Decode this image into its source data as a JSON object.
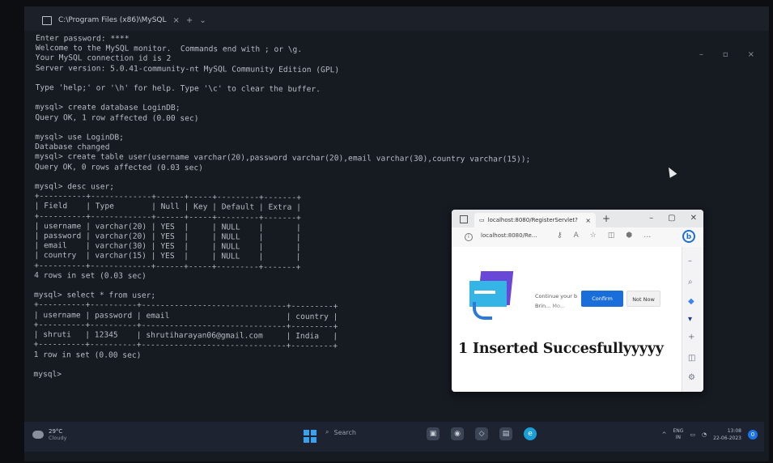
{
  "terminal": {
    "tab_title": "C:\\Program Files (x86)\\MySQL",
    "lines": [
      "Enter password: ****",
      "Welcome to the MySQL monitor.  Commands end with ; or \\g.",
      "Your MySQL connection id is 2",
      "Server version: 5.0.41-community-nt MySQL Community Edition (GPL)",
      "",
      "Type 'help;' or '\\h' for help. Type '\\c' to clear the buffer.",
      "",
      "mysql> create database LoginDB;",
      "Query OK, 1 row affected (0.00 sec)",
      "",
      "mysql> use LoginDB;",
      "Database changed",
      "mysql> create table user(username varchar(20),password varchar(20),email varchar(30),country varchar(15));",
      "Query OK, 0 rows affected (0.03 sec)",
      "",
      "mysql> desc user;",
      "+----------+-------------+------+-----+---------+-------+",
      "| Field    | Type        | Null | Key | Default | Extra |",
      "+----------+-------------+------+-----+---------+-------+",
      "| username | varchar(20) | YES  |     | NULL    |       |",
      "| password | varchar(20) | YES  |     | NULL    |       |",
      "| email    | varchar(30) | YES  |     | NULL    |       |",
      "| country  | varchar(15) | YES  |     | NULL    |       |",
      "+----------+-------------+------+-----+---------+-------+",
      "4 rows in set (0.03 sec)",
      "",
      "mysql> select * from user;",
      "+----------+----------+-------------------------------+---------+",
      "| username | password | email                         | country |",
      "+----------+----------+-------------------------------+---------+",
      "| shruti   | 12345    | shrutiharayan06@gmail.com     | India   |",
      "+----------+----------+-------------------------------+---------+",
      "1 row in set (0.00 sec)",
      "",
      "mysql>"
    ]
  },
  "browser": {
    "tab_title": "localhost:8080/RegisterServlet?",
    "address": "localhost:8080/Re...",
    "promo_line1": "Continue your b",
    "promo_line2": "Brin...",
    "promo_more": "Mo...",
    "confirm_label": "Confirm",
    "not_now_label": "Not Now",
    "heading": "1 Inserted Succesfullyyyyy"
  },
  "taskbar": {
    "temperature": "29°C",
    "condition": "Cloudy",
    "search_placeholder": "Search",
    "lang_line1": "ENG",
    "lang_line2": "IN",
    "time": "13:08",
    "date": "22-06-2023",
    "notification_count": "0"
  }
}
